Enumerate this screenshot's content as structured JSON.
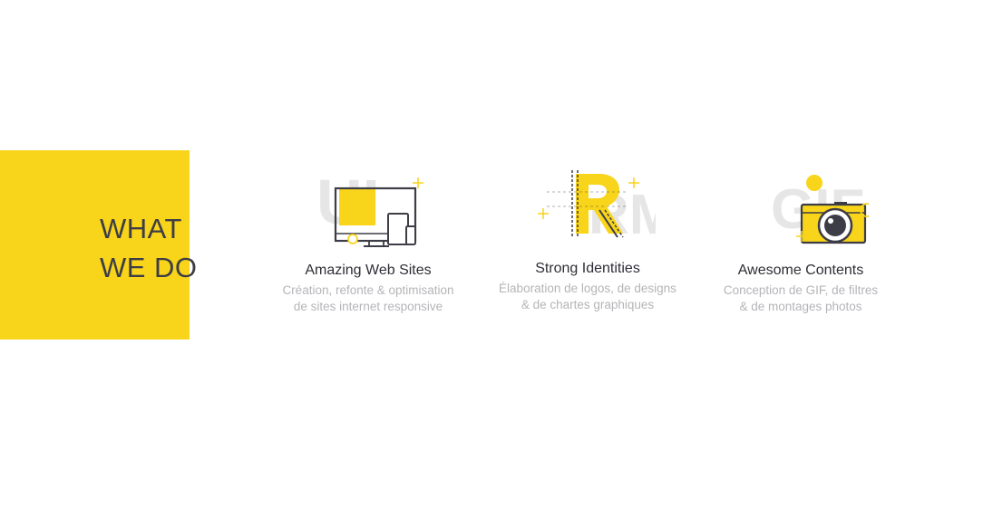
{
  "section": {
    "title_line1": "WHAT",
    "title_line2": "WE DO"
  },
  "colors": {
    "accent": "#f8d41a",
    "dark": "#3d3d47",
    "muted_text": "#b5b5b9",
    "ghost_letters": "#e6e6e6"
  },
  "services": [
    {
      "icon": "devices-icon",
      "watermark": "UI",
      "title": "Amazing Web Sites",
      "desc_line1": "Création, refonte & optimisation",
      "desc_line2": "de sites internet responsive"
    },
    {
      "icon": "letter-r-drafting-icon",
      "watermark": "RM",
      "title": "Strong Identities",
      "desc_line1": "Élaboration de logos, de designs",
      "desc_line2": "& de chartes graphiques"
    },
    {
      "icon": "camera-icon",
      "watermark": "GIF",
      "title": "Awesome Contents",
      "desc_line1": "Conception de GIF, de filtres",
      "desc_line2": "& de montages photos"
    }
  ]
}
